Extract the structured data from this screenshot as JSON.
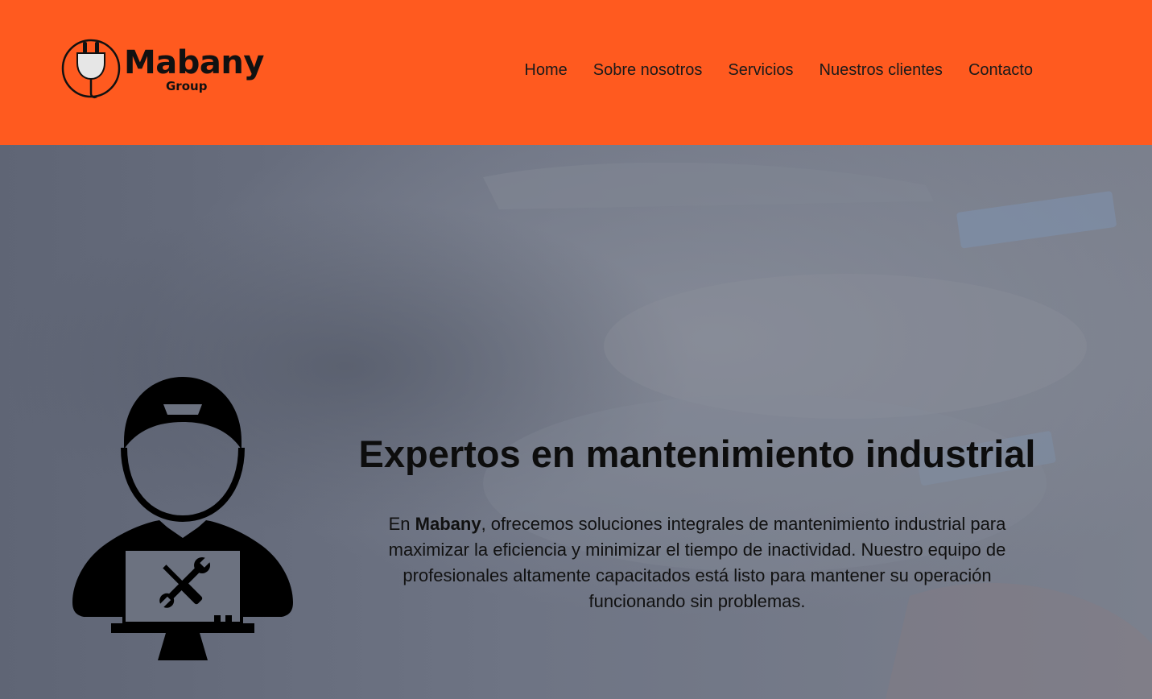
{
  "brand": {
    "name": "Mabany",
    "sub": "Group",
    "logo_icon": "plug-icon"
  },
  "nav": {
    "items": [
      {
        "label": "Home"
      },
      {
        "label": "Sobre nosotros"
      },
      {
        "label": "Servicios"
      },
      {
        "label": "Nuestros clientes"
      },
      {
        "label": "Contacto"
      }
    ]
  },
  "hero": {
    "title": "Expertos en mantenimiento industrial",
    "text_prefix": "En ",
    "text_bold": "Mabany",
    "text_rest": ", ofrecemos soluciones integrales de mantenimiento industrial para maximizar la eficiencia y minimizar el tiempo de inactividad. Nuestro equipo de profesionales altamente capacitados está listo para mantener su operación funcionando sin problemas.",
    "illustration": "technician-with-tools-icon"
  },
  "colors": {
    "header_bg": "#ff5a1f",
    "hero_overlay": "#6c7280",
    "text": "#111111"
  }
}
